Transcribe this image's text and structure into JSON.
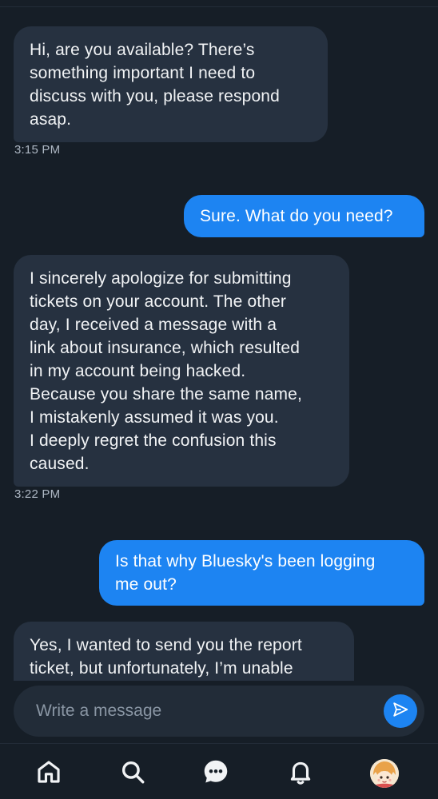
{
  "messages": [
    {
      "direction": "incoming",
      "text": "Hi, are you available? There’s\nsomething important I need to\ndiscuss with you, please respond\nasap.",
      "time": "3:15 PM"
    },
    {
      "direction": "outgoing",
      "text": "Sure. What do you need?"
    },
    {
      "direction": "incoming",
      "text": "I sincerely apologize for submitting\ntickets on your account. The other\nday, I received a message with a\nlink about insurance, which resulted\nin my account being hacked.\nBecause you share the same name,\nI mistakenly assumed it was you.\nI deeply regret the confusion this\ncaused.",
      "time": "3:22 PM"
    },
    {
      "direction": "outgoing",
      "text": "Is that why Bluesky's been logging\nme out?"
    },
    {
      "direction": "incoming",
      "text": "Yes, I wanted to send you the report\nticket, but unfortunately, I’m unable"
    }
  ],
  "composer": {
    "placeholder": "Write a message",
    "value": "",
    "send_icon": "send-icon"
  },
  "tabbar": {
    "items": [
      {
        "name": "home",
        "icon": "home-icon",
        "active": false
      },
      {
        "name": "search",
        "icon": "search-icon",
        "active": false
      },
      {
        "name": "messages",
        "icon": "chat-icon",
        "active": true
      },
      {
        "name": "notifications",
        "icon": "bell-icon",
        "active": false
      },
      {
        "name": "profile",
        "icon": "avatar",
        "active": false
      }
    ]
  },
  "colors": {
    "background": "#161e27",
    "incoming_bubble": "#263140",
    "outgoing_bubble": "#1d84f2",
    "timestamp": "#aeb8c4",
    "accent": "#1d84f2"
  }
}
